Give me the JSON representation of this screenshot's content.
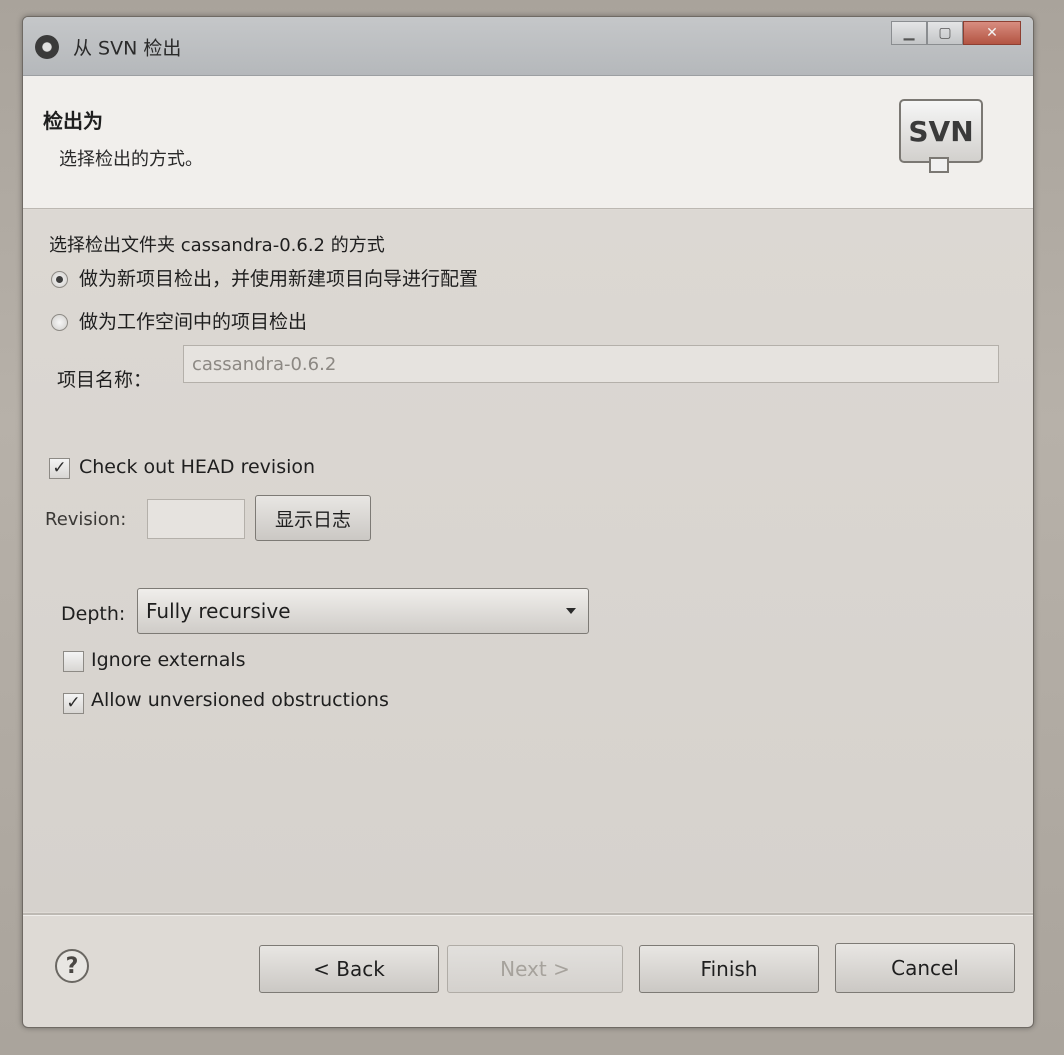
{
  "window": {
    "title": "从 SVN 检出"
  },
  "header": {
    "title": "检出为",
    "subtitle": "选择检出的方式。",
    "logo_text": "SVN"
  },
  "checkout": {
    "prompt": "选择检出文件夹 cassandra-0.6.2 的方式",
    "option_new_project": "做为新项目检出，并使用新建项目向导进行配置",
    "option_workspace": "做为工作空间中的项目检出",
    "selected_option": "option_new_project",
    "project_name_label": "项目名称：",
    "project_name_value": "cassandra-0.6.2"
  },
  "revision": {
    "head_checkbox_label": "Check out HEAD revision",
    "head_checked": true,
    "revision_label": "Revision:",
    "revision_value": "",
    "show_log_button": "显示日志"
  },
  "options": {
    "depth_label": "Depth:",
    "depth_value": "Fully recursive",
    "ignore_externals_label": "Ignore externals",
    "ignore_externals_checked": false,
    "allow_unversioned_label": "Allow unversioned obstructions",
    "allow_unversioned_checked": true
  },
  "footer": {
    "back_button": "< Back",
    "next_button": "Next >",
    "finish_button": "Finish",
    "cancel_button": "Cancel",
    "help_glyph": "?"
  }
}
